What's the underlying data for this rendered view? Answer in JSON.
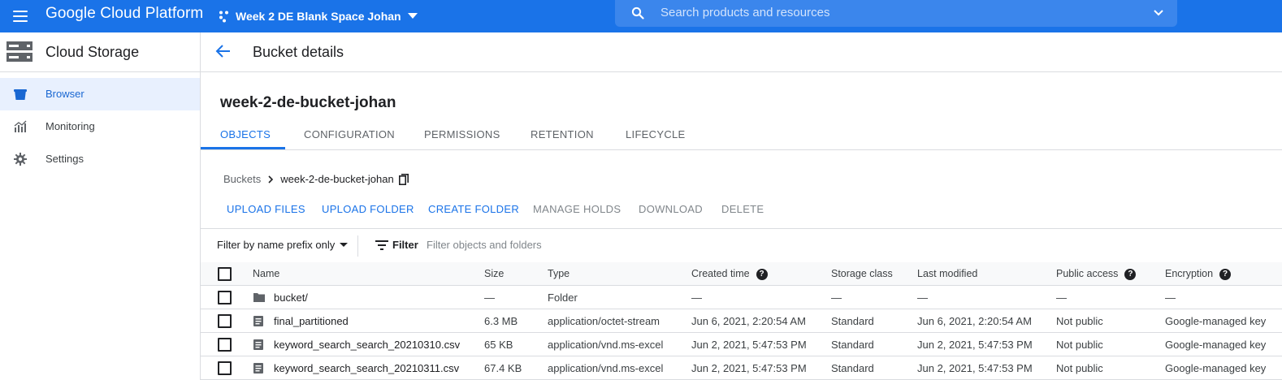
{
  "topbar": {
    "brand": "Google Cloud Platform",
    "project": "Week 2 DE Blank Space Johan",
    "search_placeholder": "Search products and resources",
    "color": "#1a73e8"
  },
  "sidenav": {
    "title": "Cloud Storage",
    "items": [
      {
        "label": "Browser",
        "icon": "bucket-icon",
        "active": true
      },
      {
        "label": "Monitoring",
        "icon": "monitoring-icon",
        "active": false
      },
      {
        "label": "Settings",
        "icon": "gear-icon",
        "active": false
      }
    ]
  },
  "page": {
    "title": "Bucket details",
    "bucket_name": "week-2-de-bucket-johan"
  },
  "tabs": [
    "OBJECTS",
    "CONFIGURATION",
    "PERMISSIONS",
    "RETENTION",
    "LIFECYCLE"
  ],
  "active_tab": "OBJECTS",
  "breadcrumb": {
    "root": "Buckets",
    "current": "week-2-de-bucket-johan"
  },
  "actions": {
    "upload_files": "UPLOAD FILES",
    "upload_folder": "UPLOAD FOLDER",
    "create_folder": "CREATE FOLDER",
    "manage_holds": "MANAGE HOLDS",
    "download": "DOWNLOAD",
    "delete": "DELETE"
  },
  "filter": {
    "mode": "Filter by name prefix only",
    "label": "Filter",
    "placeholder": "Filter objects and folders"
  },
  "table": {
    "columns": {
      "name": "Name",
      "size": "Size",
      "type": "Type",
      "created": "Created time",
      "storage_class": "Storage class",
      "modified": "Last modified",
      "public_access": "Public access",
      "encryption": "Encryption"
    },
    "rows": [
      {
        "name": "bucket/",
        "icon": "folder-icon",
        "size": "—",
        "type": "Folder",
        "created": "—",
        "storage_class": "—",
        "modified": "—",
        "public_access": "—",
        "encryption": "—"
      },
      {
        "name": "final_partitioned",
        "icon": "file-icon",
        "size": "6.3 MB",
        "type": "application/octet-stream",
        "created": "Jun 6, 2021, 2:20:54 AM",
        "storage_class": "Standard",
        "modified": "Jun 6, 2021, 2:20:54 AM",
        "public_access": "Not public",
        "encryption": "Google-managed key"
      },
      {
        "name": "keyword_search_search_20210310.csv",
        "icon": "file-icon",
        "size": "65 KB",
        "type": "application/vnd.ms-excel",
        "created": "Jun 2, 2021, 5:47:53 PM",
        "storage_class": "Standard",
        "modified": "Jun 2, 2021, 5:47:53 PM",
        "public_access": "Not public",
        "encryption": "Google-managed key"
      },
      {
        "name": "keyword_search_search_20210311.csv",
        "icon": "file-icon",
        "size": "67.4 KB",
        "type": "application/vnd.ms-excel",
        "created": "Jun 2, 2021, 5:47:53 PM",
        "storage_class": "Standard",
        "modified": "Jun 2, 2021, 5:47:53 PM",
        "public_access": "Not public",
        "encryption": "Google-managed key"
      }
    ]
  }
}
